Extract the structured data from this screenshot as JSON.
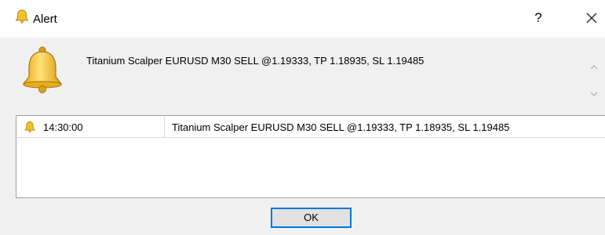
{
  "window": {
    "title": "Alert",
    "help_label": "?"
  },
  "alert": {
    "message": "Titanium Scalper EURUSD M30 SELL @1.19333, TP 1.18935, SL 1.19485"
  },
  "log": {
    "rows": [
      {
        "time": "14:30:00",
        "message": "Titanium Scalper EURUSD M30 SELL @1.19333, TP 1.18935, SL 1.19485"
      }
    ]
  },
  "buttons": {
    "ok_label": "OK"
  },
  "colors": {
    "bell_gold": "#f2c22a",
    "focus_border": "#0078d7",
    "dialog_bg": "#f0f0f0"
  },
  "icons": {
    "title": "bell-icon",
    "message": "bell-icon",
    "row": "bell-icon",
    "close": "close-icon",
    "scroll_up": "chevron-up-icon",
    "scroll_down": "chevron-down-icon"
  }
}
